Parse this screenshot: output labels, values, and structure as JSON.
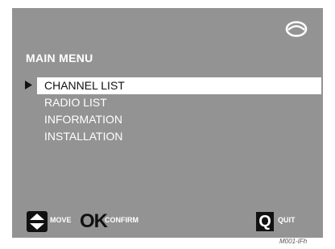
{
  "screen": {
    "title": "MAIN MENU",
    "menu_items": [
      {
        "label": "CHANNEL LIST",
        "selected": true
      },
      {
        "label": "RADIO LIST",
        "selected": false
      },
      {
        "label": "INFORMATION",
        "selected": false
      },
      {
        "label": "INSTALLATION",
        "selected": false
      }
    ],
    "footer": {
      "move": {
        "icon": "up-down-arrows-icon",
        "label": "MOVE"
      },
      "confirm": {
        "icon": "ok-key-icon",
        "key": "OK",
        "label": "CONFIRM"
      },
      "quit": {
        "icon": "q-key-icon",
        "key": "Q",
        "label": "QUIT"
      }
    },
    "logo": "eye-logo-icon",
    "cursor": "triangle-pointer-icon"
  },
  "figure_code": "M001-IFh",
  "colors": {
    "panel_bg": "#939393",
    "text": "#ffffff",
    "selected_bg": "#ffffff",
    "selected_text": "#111111",
    "key_bg": "#111111"
  }
}
